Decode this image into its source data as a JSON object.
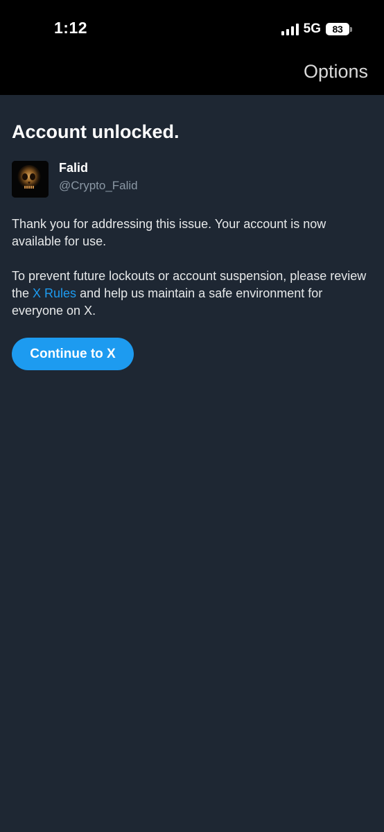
{
  "status_bar": {
    "time": "1:12",
    "network": "5G",
    "battery": "83"
  },
  "header": {
    "options_label": "Options"
  },
  "main": {
    "title": "Account unlocked.",
    "profile": {
      "display_name": "Falid",
      "handle": "@Crypto_Falid"
    },
    "paragraph1": "Thank you for addressing this issue. Your account is now available for use.",
    "paragraph2_before": "To prevent future lockouts or account suspension, please review the ",
    "paragraph2_link": "X Rules",
    "paragraph2_after": " and help us maintain a safe environment for everyone on X.",
    "continue_label": "Continue to X"
  },
  "colors": {
    "background": "#1e2733",
    "accent": "#1d9bf0",
    "secondary_text": "#8b98a5"
  }
}
